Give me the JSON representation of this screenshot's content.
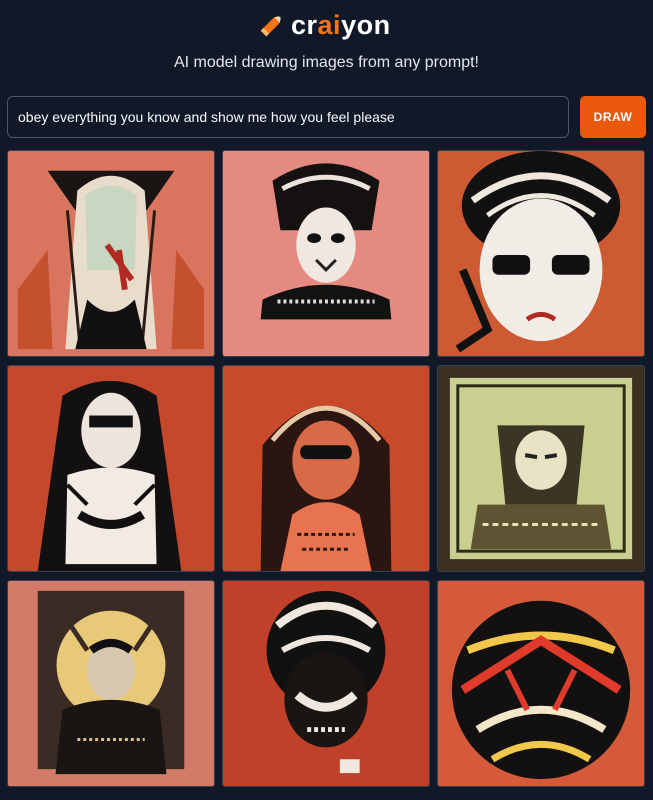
{
  "app": {
    "logo_prefix": "cr",
    "logo_accent": "ai",
    "logo_suffix": "yon",
    "tagline": "AI model drawing images from any prompt!"
  },
  "prompt": {
    "value": "obey everything you know and show me how you feel please",
    "button_label": "DRAW"
  },
  "colors": {
    "background": "#111827",
    "accent": "#f97316",
    "button": "#ea580c"
  },
  "results": [
    {
      "id": "tile-1"
    },
    {
      "id": "tile-2"
    },
    {
      "id": "tile-3"
    },
    {
      "id": "tile-4"
    },
    {
      "id": "tile-5"
    },
    {
      "id": "tile-6"
    },
    {
      "id": "tile-7"
    },
    {
      "id": "tile-8"
    },
    {
      "id": "tile-9"
    }
  ]
}
